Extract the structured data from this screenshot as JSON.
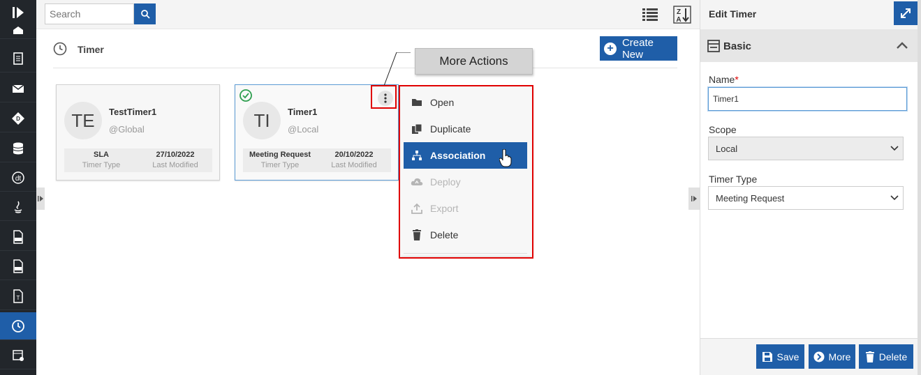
{
  "search": {
    "placeholder": "Search"
  },
  "page": {
    "title": "Timer",
    "create_label": "Create New"
  },
  "cards": [
    {
      "initials": "TE",
      "name": "TestTimer1",
      "scope": "@Global",
      "timer_type": "SLA",
      "timer_type_label": "Timer Type",
      "modified": "27/10/2022",
      "modified_label": "Last Modified"
    },
    {
      "initials": "TI",
      "name": "Timer1",
      "scope": "@Local",
      "timer_type": "Meeting Request",
      "timer_type_label": "Timer Type",
      "modified": "20/10/2022",
      "modified_label": "Last Modified"
    }
  ],
  "context_menu": {
    "items": [
      {
        "label": "Open",
        "icon": "folder-open-icon",
        "state": "normal"
      },
      {
        "label": "Duplicate",
        "icon": "copy-icon",
        "state": "normal"
      },
      {
        "label": "Association",
        "icon": "sitemap-icon",
        "state": "highlighted"
      },
      {
        "label": "Deploy",
        "icon": "cloud-upload-icon",
        "state": "disabled"
      },
      {
        "label": "Export",
        "icon": "upload-icon",
        "state": "disabled"
      },
      {
        "label": "Delete",
        "icon": "trash-icon",
        "state": "normal"
      }
    ]
  },
  "tooltip": {
    "text": "More Actions"
  },
  "edit_panel": {
    "title": "Edit Timer",
    "section": "Basic",
    "name_label": "Name",
    "name_required": "*",
    "name_value": "Timer1",
    "scope_label": "Scope",
    "scope_value": "Local",
    "type_label": "Timer Type",
    "type_value": "Meeting Request",
    "save_label": "Save",
    "more_label": "More",
    "delete_label": "Delete"
  },
  "colors": {
    "accent": "#1f5ea8",
    "sidebar": "#22262b",
    "highlight_box": "#e00000",
    "success": "#2e9e4f"
  }
}
